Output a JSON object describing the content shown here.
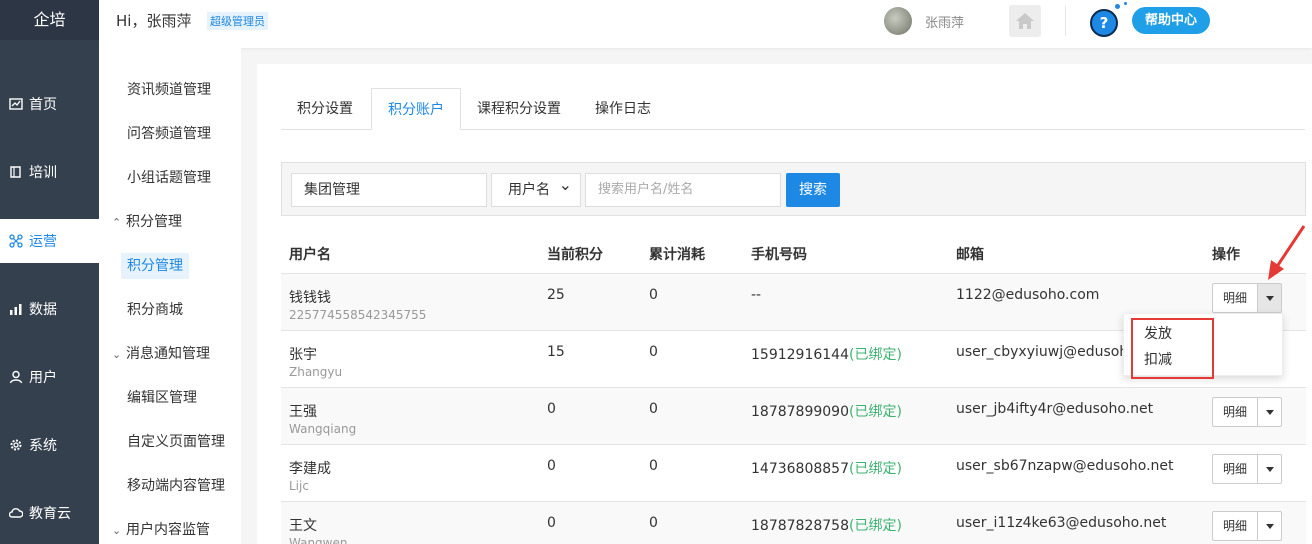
{
  "brand": "企培",
  "mainnav": [
    {
      "label": "首页",
      "icon": "chart-icon"
    },
    {
      "label": "培训",
      "icon": "book-icon"
    },
    {
      "label": "运营",
      "icon": "network-icon"
    },
    {
      "label": "数据",
      "icon": "bar-chart-icon"
    },
    {
      "label": "用户",
      "icon": "user-icon"
    },
    {
      "label": "系统",
      "icon": "gear-icon"
    },
    {
      "label": "教育云",
      "icon": "cloud-icon"
    }
  ],
  "topbar": {
    "greeting": "Hi，张雨萍",
    "role": "超级管理员",
    "username": "张雨萍",
    "help_label": "帮助中心",
    "help_q": "?"
  },
  "subnav": {
    "items": [
      "资讯频道管理",
      "问答频道管理",
      "小组话题管理"
    ],
    "group1": "积分管理",
    "group1_items": [
      "积分管理",
      "积分商城"
    ],
    "group2": "消息通知管理",
    "group2_items": [
      "编辑区管理",
      "自定义页面管理",
      "移动端内容管理"
    ],
    "group3": "用户内容监管"
  },
  "tabs": [
    "积分设置",
    "积分账户",
    "课程积分设置",
    "操作日志"
  ],
  "search": {
    "org_value": "集团管理",
    "field_select": "用户名",
    "keyword_placeholder": "搜索用户名/姓名",
    "button": "搜索"
  },
  "table": {
    "headers": [
      "用户名",
      "当前积分",
      "累计消耗",
      "手机号码",
      "邮箱",
      "操作"
    ],
    "rows": [
      {
        "name": "钱钱钱",
        "sub": "225774558542345755",
        "points": "25",
        "consumed": "0",
        "phone": "--",
        "bound": "",
        "email": "1122@edusoho.com",
        "op": "明细"
      },
      {
        "name": "张宇",
        "sub": "Zhangyu",
        "points": "15",
        "consumed": "0",
        "phone": "15912916144",
        "bound": "(已绑定)",
        "email": "user_cbyxyiuwj@edusoho.",
        "op": "明细"
      },
      {
        "name": "王强",
        "sub": "Wangqiang",
        "points": "0",
        "consumed": "0",
        "phone": "18787899090",
        "bound": "(已绑定)",
        "email": "user_jb4ifty4r@edusoho.net",
        "op": "明细"
      },
      {
        "name": "李建成",
        "sub": "Lijc",
        "points": "0",
        "consumed": "0",
        "phone": "14736808857",
        "bound": "(已绑定)",
        "email": "user_sb67nzapw@edusoho.net",
        "op": "明细"
      },
      {
        "name": "王文",
        "sub": "Wangwen",
        "points": "0",
        "consumed": "0",
        "phone": "18787828758",
        "bound": "(已绑定)",
        "email": "user_i11z4ke63@edusoho.net",
        "op": "明细"
      }
    ]
  },
  "dropdown": [
    "发放",
    "扣减"
  ],
  "colors": {
    "accent": "#1e88e5",
    "nav_bg": "#35404e",
    "bound": "#3cb371",
    "annotation": "#e53935"
  }
}
